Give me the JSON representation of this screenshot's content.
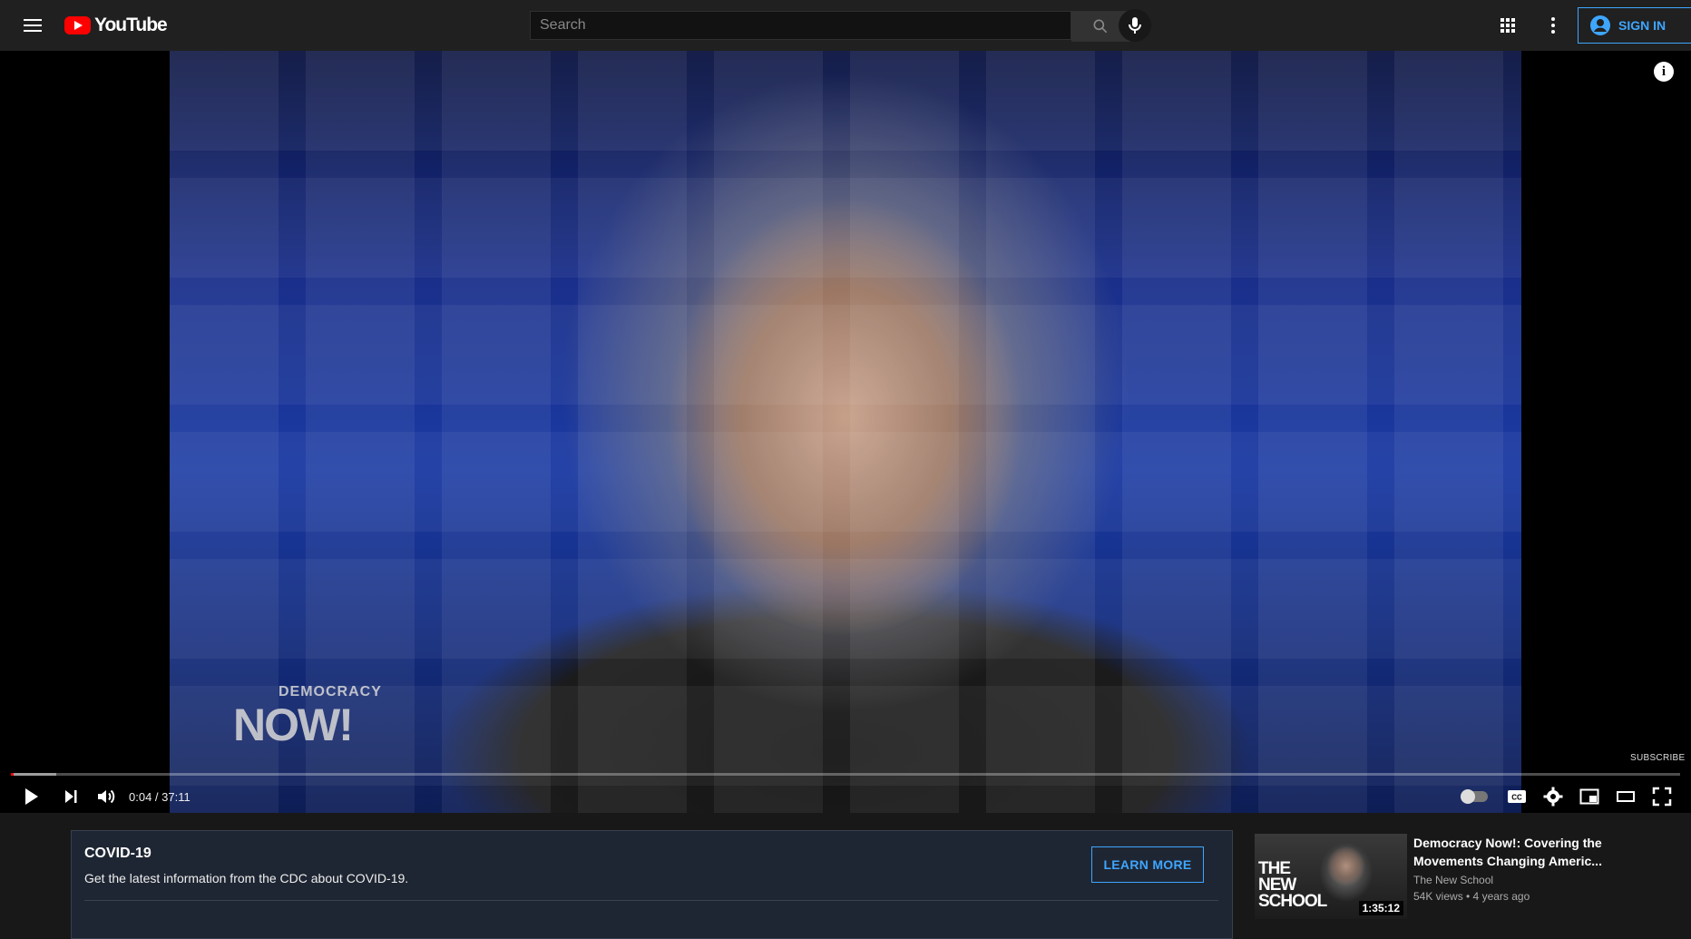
{
  "header": {
    "logo_text": "YouTube",
    "search_placeholder": "Search",
    "sign_in_label": "SIGN IN"
  },
  "player": {
    "watermark_top": "DEMOCRACY",
    "watermark_bottom": "NOW!",
    "subscribe_watermark": "SUBSCRIBE",
    "info_symbol": "i",
    "current_time": "0:04",
    "duration": "37:11",
    "time_display": "0:04 / 37:11",
    "progress_played_fraction": 0.0018,
    "progress_buffered_fraction": 0.027
  },
  "covid_banner": {
    "title": "COVID-19",
    "text": "Get the latest information from the CDC about COVID-19.",
    "button_label": "LEARN MORE"
  },
  "recommendations": [
    {
      "title": "Democracy Now!: Covering the Movements Changing Americ...",
      "channel": "The New School",
      "meta": "54K views • 4 years ago",
      "duration": "1:35:12",
      "thumb_text": "THE NEW SCHOOL"
    }
  ],
  "colors": {
    "accent_blue": "#3ea6ff",
    "brand_red": "#ff0000",
    "header_bg": "#202020",
    "page_bg": "#181818"
  }
}
